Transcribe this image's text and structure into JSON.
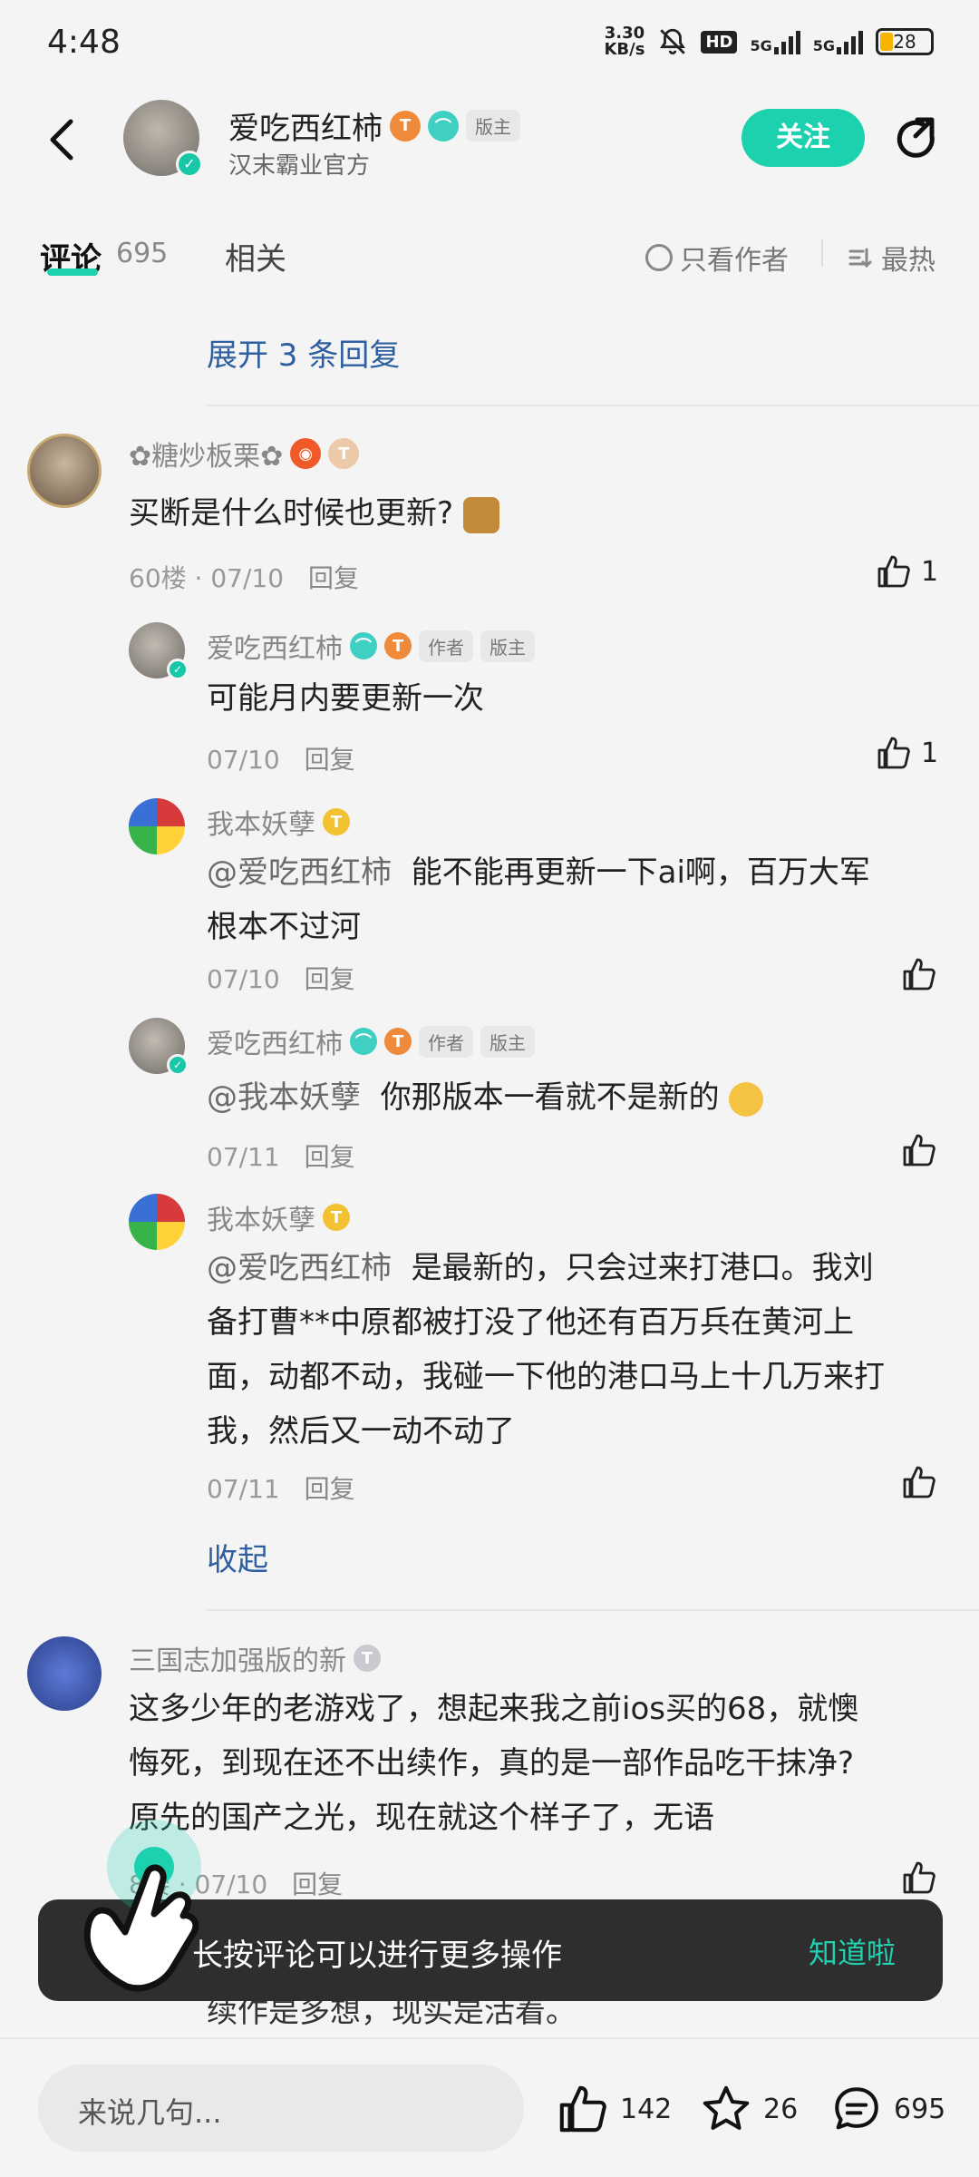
{
  "status_bar": {
    "time": "4:48",
    "net_speed_value": "3.30",
    "net_speed_unit": "KB/s",
    "hd_label": "HD",
    "signal_1_label": "5G",
    "signal_2_label": "5G",
    "battery": "28"
  },
  "header": {
    "name": "爱吃西红柿",
    "badge_t": "T",
    "tag": "版主",
    "subtitle": "汉末霸业官方",
    "follow_label": "关注"
  },
  "tabs": {
    "comments_label": "评论",
    "comments_count": "695",
    "related_label": "相关",
    "author_only_label": "只看作者",
    "sort_label": "最热"
  },
  "thread_top": {
    "expand_label": "展开 3 条回复"
  },
  "comment_60": {
    "user": "✿糖炒板栗✿",
    "badge_t": "T",
    "text": "买断是什么时候也更新?",
    "floor": "60楼",
    "date": "07/10",
    "reply_label": "回复",
    "likes": "1",
    "replies": [
      {
        "user": "爱吃西红柿",
        "badge_t": "T",
        "tag_author": "作者",
        "tag_mod": "版主",
        "mention": "",
        "text": "可能月内要更新一次",
        "date": "07/10",
        "reply_label": "回复",
        "likes": "1"
      },
      {
        "user": "我本妖孽",
        "badge_t": "T",
        "mention": "@爱吃西红柿",
        "text_line1": "能不能再更新一下ai啊，百万大军",
        "text_line2": "根本不过河",
        "date": "07/10",
        "reply_label": "回复"
      },
      {
        "user": "爱吃西红柿",
        "badge_t": "T",
        "tag_author": "作者",
        "tag_mod": "版主",
        "mention": "@我本妖孽",
        "text": "你那版本一看就不是新的",
        "date": "07/11",
        "reply_label": "回复"
      },
      {
        "user": "我本妖孽",
        "badge_t": "T",
        "mention": "@爱吃西红柿",
        "text_line1": "是最新的，只会过来打港口。我刘",
        "text_line2": "备打曹**中原都被打没了他还有百万兵在黄河上",
        "text_line3": "面，动都不动，我碰一下他的港口马上十几万来打",
        "text_line4": "我，然后又一动不动了",
        "date": "07/11",
        "reply_label": "回复"
      }
    ],
    "collapse_label": "收起"
  },
  "comment_next": {
    "user": "三国志加强版的新",
    "badge_t": "T",
    "text_line1": "这多少年的老游戏了，想起来我之前ios买的68，就懊",
    "text_line2": "悔死，到现在还不出续作，真的是一部作品吃干抹净?",
    "text_line3": "原先的国产之光，现在就这个样子了，无语",
    "floor": "8楼",
    "date": "07/10",
    "reply_label": "回复",
    "peek_text": "续作是多想，现实是活着。"
  },
  "toast": {
    "text": "长按评论可以进行更多操作",
    "ok_label": "知道啦"
  },
  "bottom_bar": {
    "input_placeholder": "来说几句...",
    "likes": "142",
    "stars": "26",
    "comments": "695"
  },
  "colors": {
    "accent": "#1cd1ae",
    "link": "#2e5fa0",
    "toast_bg": "#2e2e2e"
  }
}
